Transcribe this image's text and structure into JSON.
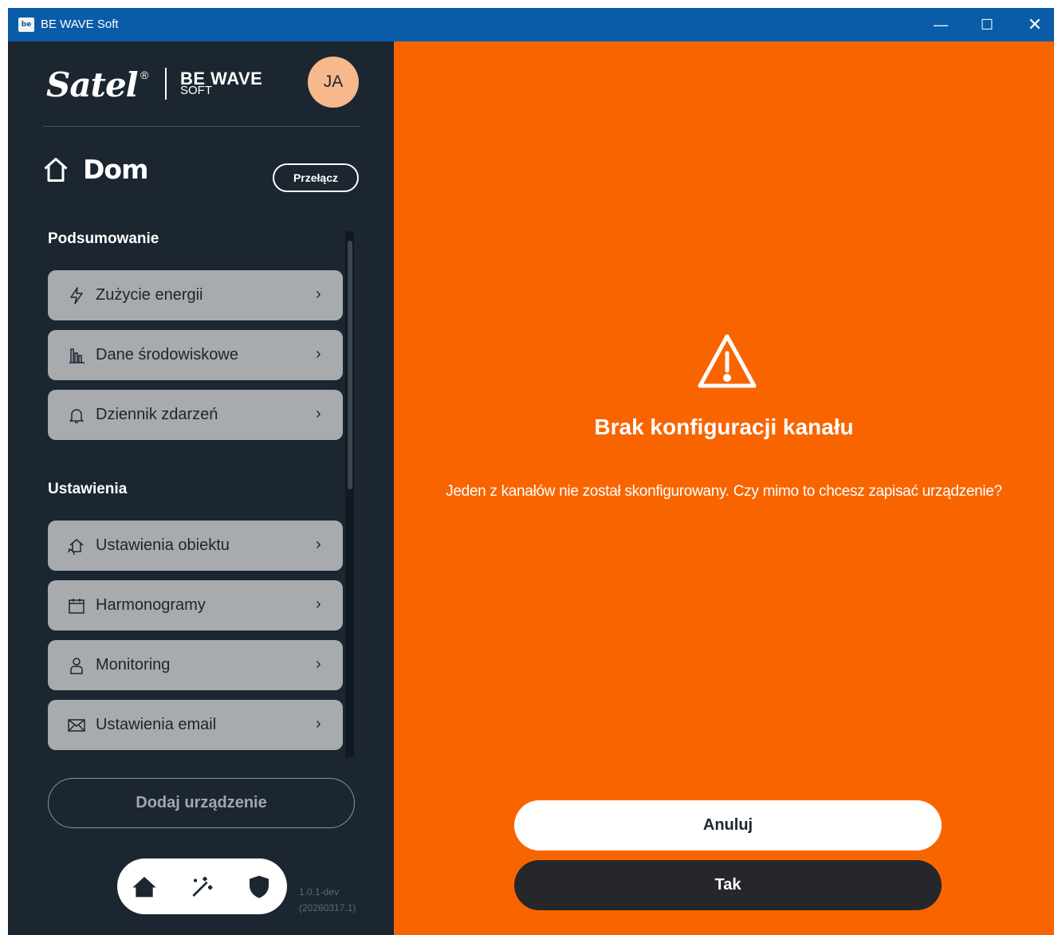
{
  "window": {
    "title": "BE WAVE Soft",
    "logo_text": "be",
    "controls": {
      "minimize": "—",
      "maximize": "☐",
      "close": "✕"
    }
  },
  "brand": {
    "satel": "Satel",
    "reg_mark": "®",
    "bewave_line1": "BE WAVE",
    "bewave_line2": "SOFT"
  },
  "user": {
    "initials": "JA"
  },
  "home": {
    "title": "Dom",
    "switch_label": "Przełącz"
  },
  "sections": {
    "summary": {
      "title": "Podsumowanie",
      "items": [
        {
          "label": "Zużycie energii",
          "icon": "lightning-icon"
        },
        {
          "label": "Dane środowiskowe",
          "icon": "chart-bars-icon"
        },
        {
          "label": "Dziennik zdarzeń",
          "icon": "bell-icon"
        }
      ]
    },
    "settings": {
      "title": "Ustawienia",
      "items": [
        {
          "label": "Ustawienia obiektu",
          "icon": "house-wifi-icon"
        },
        {
          "label": "Harmonogramy",
          "icon": "calendar-icon"
        },
        {
          "label": "Monitoring",
          "icon": "person-icon"
        },
        {
          "label": "Ustawienia email",
          "icon": "envelope-icon"
        }
      ]
    }
  },
  "add_device": "Dodaj urządzenie",
  "bottom_nav": [
    "home-icon",
    "magic-wand-icon",
    "shield-icon"
  ],
  "version": {
    "line1": "1.0.1-dev",
    "line2": "(20260317.1)"
  },
  "dialog": {
    "title": "Brak konfiguracji kanału",
    "message": "Jeden z kanałów nie został skonfigurowany. Czy mimo to chcesz zapisać urządzenie?",
    "cancel": "Anuluj",
    "confirm": "Tak"
  },
  "colors": {
    "sidebar_bg": "#1b2631",
    "titlebar_bg": "#0b5ca8",
    "main_bg": "#f86500",
    "avatar_bg": "#f7b98c",
    "item_bg": "#a7abae",
    "confirm_bg": "#25272a"
  }
}
